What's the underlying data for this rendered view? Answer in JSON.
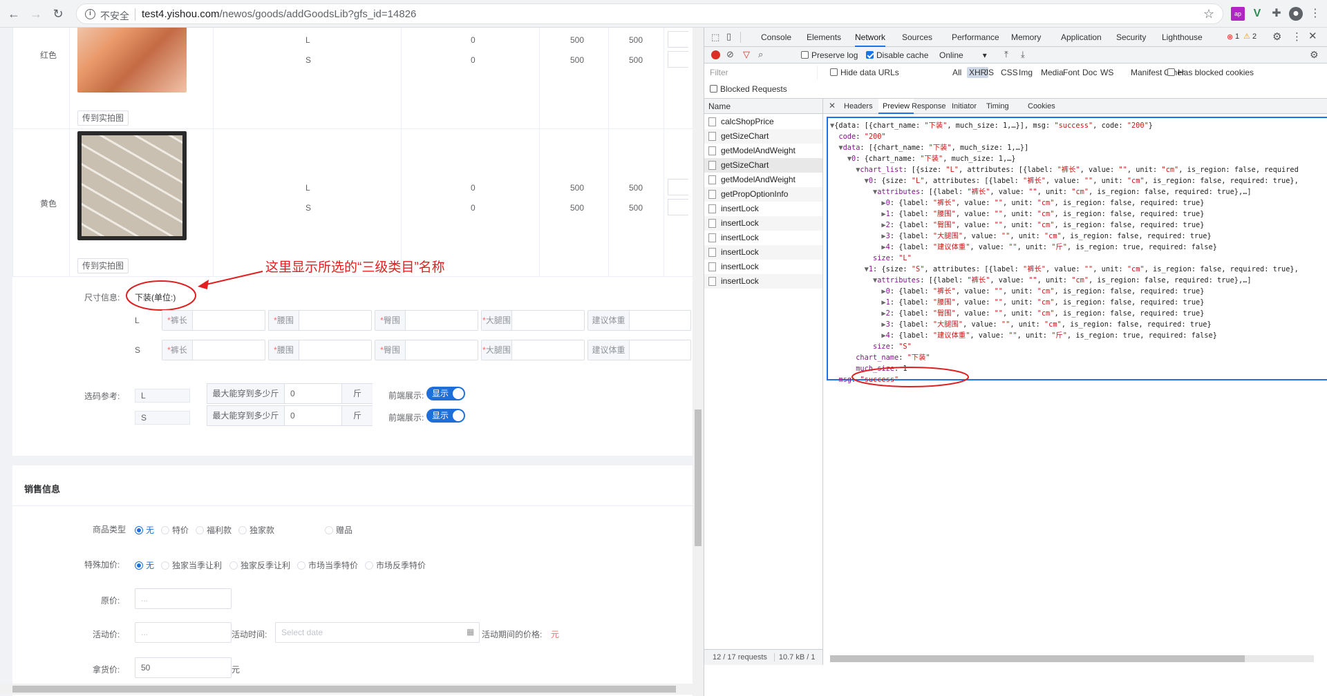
{
  "browser": {
    "insecure_label": "不安全",
    "url_host": "test4.yishou.com",
    "url_path": "/newos/goods/addGoodsLib?gfs_id=14826"
  },
  "sku_table": {
    "rows": [
      {
        "color": "红色",
        "photo_button": "传到实拍图",
        "sizes": [
          {
            "size": "L",
            "a": "0",
            "b": "500",
            "c": "500"
          },
          {
            "size": "S",
            "a": "0",
            "b": "500",
            "c": "500"
          }
        ]
      },
      {
        "color": "黄色",
        "photo_button": "传到实拍图",
        "sizes": [
          {
            "size": "L",
            "a": "0",
            "b": "500",
            "c": "500"
          },
          {
            "size": "S",
            "a": "0",
            "b": "500",
            "c": "500"
          }
        ]
      }
    ]
  },
  "annotation": {
    "note": "这里显示所选的“三级类目”名称"
  },
  "size_info": {
    "label": "尺寸信息:",
    "category": "下装(单位:)",
    "rows": [
      {
        "size": "L",
        "fields": [
          {
            "req": "*",
            "name": "裤长"
          },
          {
            "req": "*",
            "name": "腰围"
          },
          {
            "req": "*",
            "name": "臀围"
          },
          {
            "req": "*",
            "name": "大腿围"
          },
          {
            "req": "",
            "name": "建议体重"
          }
        ]
      },
      {
        "size": "S",
        "fields": [
          {
            "req": "*",
            "name": "裤长"
          },
          {
            "req": "*",
            "name": "腰围"
          },
          {
            "req": "*",
            "name": "臀围"
          },
          {
            "req": "*",
            "name": "大腿围"
          },
          {
            "req": "",
            "name": "建议体重"
          }
        ]
      }
    ]
  },
  "size_ref": {
    "label": "选码参考:",
    "rows": [
      {
        "size": "L",
        "max_label": "最大能穿到多少斤",
        "value": "0",
        "unit": "斤",
        "front_label": "前端展示:",
        "toggle": "显示"
      },
      {
        "size": "S",
        "max_label": "最大能穿到多少斤",
        "value": "0",
        "unit": "斤",
        "front_label": "前端展示:",
        "toggle": "显示"
      }
    ]
  },
  "sales": {
    "title": "销售信息",
    "goods_type_label": "商品类型",
    "goods_types": [
      "无",
      "特价",
      "福利款",
      "独家款",
      "赠品"
    ],
    "special_label": "特殊加价:",
    "special_opts": [
      "无",
      "独家当季让利",
      "独家反季让利",
      "市场当季特价",
      "市场反季特价"
    ],
    "orig_label": "原价:",
    "orig_placeholder": "...",
    "promo_label": "活动价:",
    "promo_placeholder": "...",
    "promo_time_label": "活动时间:",
    "date_placeholder": "Select date",
    "promo_period_label": "活动期间的价格:",
    "promo_period_value": "元",
    "take_label": "拿货价:",
    "take_value": "50",
    "take_unit": "元"
  },
  "devtools": {
    "tabs": [
      "Console",
      "Elements",
      "Network",
      "Sources",
      "Performance",
      "Memory",
      "Application",
      "Security",
      "Lighthouse"
    ],
    "active_tab": "Network",
    "errors": "1",
    "warnings": "2",
    "preserve_log": "Preserve log",
    "disable_cache": "Disable cache",
    "throttle": "Online",
    "filter_placeholder": "Filter",
    "hide_data_urls": "Hide data URLs",
    "filter_types": [
      "All",
      "XHR",
      "JS",
      "CSS",
      "Img",
      "Media",
      "Font",
      "Doc",
      "WS",
      "Manifest",
      "Other"
    ],
    "has_blocked": "Has blocked cookies",
    "blocked_requests": "Blocked Requests",
    "name_header": "Name",
    "requests": [
      "calcShopPrice",
      "getSizeChart",
      "getModelAndWeight",
      "getSizeChart",
      "getModelAndWeight",
      "getPropOptionInfo",
      "insertLock",
      "insertLock",
      "insertLock",
      "insertLock",
      "insertLock",
      "insertLock"
    ],
    "detail_tabs": [
      "Headers",
      "Preview",
      "Response",
      "Initiator",
      "Timing",
      "Cookies"
    ],
    "active_detail": "Preview",
    "status_requests": "12 / 17 requests",
    "status_size": "10.7 kB / 1"
  },
  "preview": {
    "lines": [
      "▼{data: [{chart_name: \"下装\", much_size: 1,…}], msg: \"success\", code: \"200\"}",
      "  code: \"200\"",
      "  ▼data: [{chart_name: \"下装\", much_size: 1,…}]",
      "    ▼0: {chart_name: \"下装\", much_size: 1,…}",
      "      ▼chart_list: [{size: \"L\", attributes: [{label: \"裤长\", value: \"\", unit: \"cm\", is_region: false, required",
      "        ▼0: {size: \"L\", attributes: [{label: \"裤长\", value: \"\", unit: \"cm\", is_region: false, required: true},",
      "          ▼attributes: [{label: \"裤长\", value: \"\", unit: \"cm\", is_region: false, required: true},…]",
      "            ▶0: {label: \"裤长\", value: \"\", unit: \"cm\", is_region: false, required: true}",
      "            ▶1: {label: \"腰围\", value: \"\", unit: \"cm\", is_region: false, required: true}",
      "            ▶2: {label: \"臀围\", value: \"\", unit: \"cm\", is_region: false, required: true}",
      "            ▶3: {label: \"大腿围\", value: \"\", unit: \"cm\", is_region: false, required: true}",
      "            ▶4: {label: \"建议体重\", value: \"\", unit: \"斤\", is_region: true, required: false}",
      "          size: \"L\"",
      "        ▼1: {size: \"S\", attributes: [{label: \"裤长\", value: \"\", unit: \"cm\", is_region: false, required: true},",
      "          ▼attributes: [{label: \"裤长\", value: \"\", unit: \"cm\", is_region: false, required: true},…]",
      "            ▶0: {label: \"裤长\", value: \"\", unit: \"cm\", is_region: false, required: true}",
      "            ▶1: {label: \"腰围\", value: \"\", unit: \"cm\", is_region: false, required: true}",
      "            ▶2: {label: \"臀围\", value: \"\", unit: \"cm\", is_region: false, required: true}",
      "            ▶3: {label: \"大腿围\", value: \"\", unit: \"cm\", is_region: false, required: true}",
      "            ▶4: {label: \"建议体重\", value: \"\", unit: \"斤\", is_region: true, required: false}",
      "          size: \"S\"",
      "      chart_name: \"下装\"",
      "      much_size: 1",
      "  msg: \"success\""
    ]
  },
  "colors": {
    "accent": "#1e6fd9",
    "annotation_red": "#e02020",
    "devtools_blue": "#1a73e8"
  }
}
